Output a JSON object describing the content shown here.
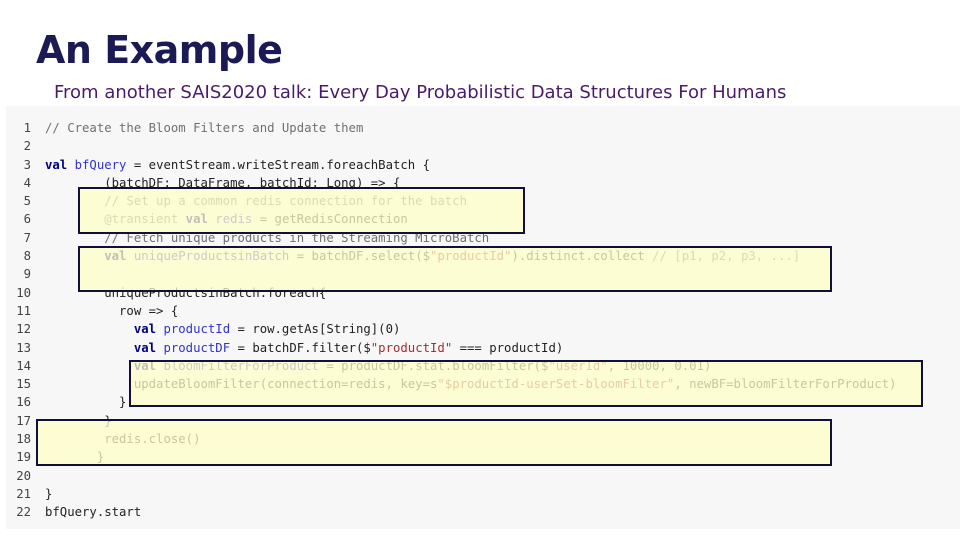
{
  "slide": {
    "title": "An Example",
    "subtitle": "From another SAIS2020 talk: Every Day Probabilistic Data Structures For Humans"
  },
  "code": {
    "lines": [
      [
        {
          "c": "cm",
          "t": "// Create the Bloom Filters and Update them"
        }
      ],
      [],
      [
        {
          "c": "kw",
          "t": "val "
        },
        {
          "c": "id",
          "t": "bfQuery"
        },
        {
          "c": "t",
          "t": " = eventStream.writeStream.foreachBatch {"
        }
      ],
      [
        {
          "c": "t",
          "t": "        (batchDF: DataFrame, batchId: Long) => {"
        }
      ],
      [
        {
          "c": "cm",
          "t": "        // Set up a common redis connection for the batch"
        }
      ],
      [
        {
          "c": "cm",
          "t": "        @transient "
        },
        {
          "c": "kw",
          "t": "val "
        },
        {
          "c": "id",
          "t": "redis"
        },
        {
          "c": "t",
          "t": " = getRedisConnection"
        }
      ],
      [
        {
          "c": "cm",
          "t": "        // Fetch unique products in the Streaming MicroBatch"
        }
      ],
      [
        {
          "c": "t",
          "t": "        "
        },
        {
          "c": "kw",
          "t": "val "
        },
        {
          "c": "id",
          "t": "uniqueProductsinBatch"
        },
        {
          "c": "t",
          "t": " = batchDF.select($"
        },
        {
          "c": "st",
          "t": "\"productId\""
        },
        {
          "c": "t",
          "t": ").distinct.collect "
        },
        {
          "c": "cm",
          "t": "// [p1, p2, p3, ...]"
        }
      ],
      [],
      [
        {
          "c": "t",
          "t": "        uniqueProductsinBatch.foreach{"
        }
      ],
      [
        {
          "c": "t",
          "t": "          row => {"
        }
      ],
      [
        {
          "c": "t",
          "t": "            "
        },
        {
          "c": "kw",
          "t": "val "
        },
        {
          "c": "id",
          "t": "productId"
        },
        {
          "c": "t",
          "t": " = row.getAs[String](0)"
        }
      ],
      [
        {
          "c": "t",
          "t": "            "
        },
        {
          "c": "kw",
          "t": "val "
        },
        {
          "c": "id",
          "t": "productDF"
        },
        {
          "c": "t",
          "t": " = batchDF.filter($"
        },
        {
          "c": "st",
          "t": "\"productId\""
        },
        {
          "c": "t",
          "t": " === productId)"
        }
      ],
      [
        {
          "c": "t",
          "t": "            "
        },
        {
          "c": "kw",
          "t": "val "
        },
        {
          "c": "id",
          "t": "bloomFilterForProduct"
        },
        {
          "c": "t",
          "t": " = productDF.stat.bloomFilter($"
        },
        {
          "c": "st",
          "t": "\"userId\""
        },
        {
          "c": "t",
          "t": ", 10000, 0.01)"
        }
      ],
      [
        {
          "c": "t",
          "t": "            updateBloomFilter(connection=redis, key=s"
        },
        {
          "c": "st",
          "t": "\"$productId-userSet-bloomFilter\""
        },
        {
          "c": "t",
          "t": ", newBF=bloomFilterForProduct)"
        }
      ],
      [
        {
          "c": "t",
          "t": "          }"
        }
      ],
      [
        {
          "c": "t",
          "t": "        }"
        }
      ],
      [
        {
          "c": "t",
          "t": "        redis.close()"
        }
      ],
      [
        {
          "c": "t",
          "t": "       }"
        }
      ],
      [],
      [
        {
          "c": "t",
          "t": "}"
        }
      ],
      [
        {
          "c": "t",
          "t": "bfQuery.start"
        }
      ]
    ]
  }
}
